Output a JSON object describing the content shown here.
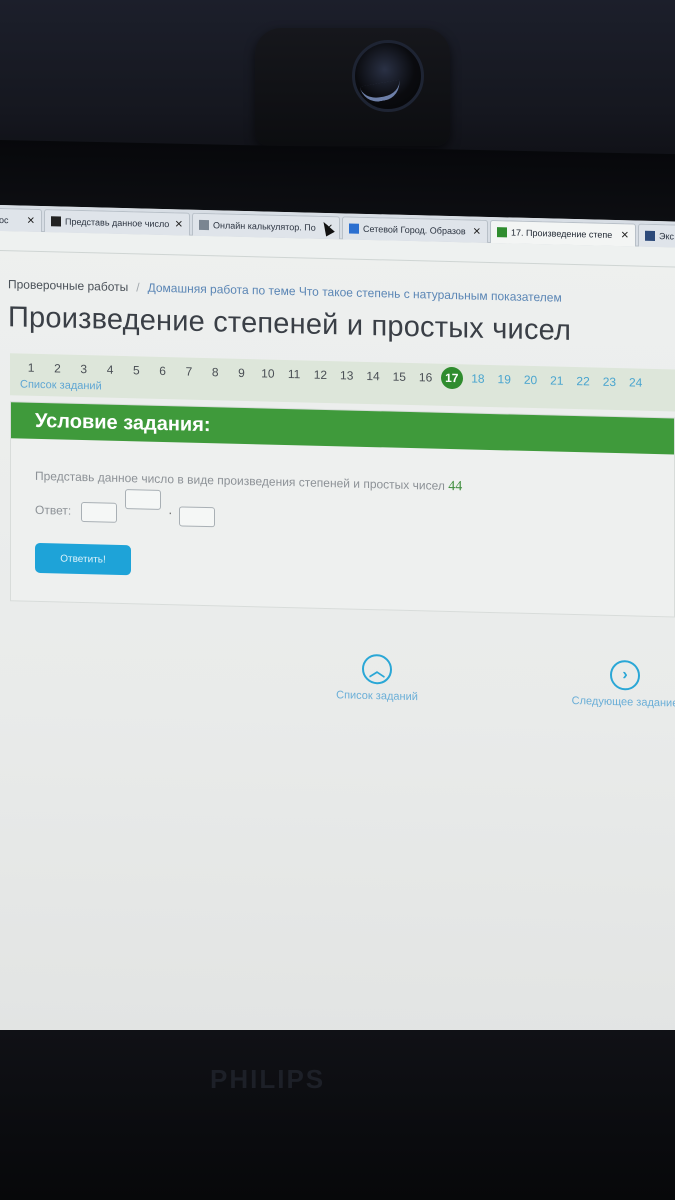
{
  "browser": {
    "tabs": [
      {
        "label": "ос",
        "favicon_color": "#c9cfd6"
      },
      {
        "label": "Представь данное число",
        "favicon_color": "#222222"
      },
      {
        "label": "Онлайн калькулятор. По",
        "favicon_color": "#7a8591"
      },
      {
        "label": "Сетевой Город. Образов",
        "favicon_color": "#2b6fd0"
      },
      {
        "label": "17. Произведение степе",
        "favicon_color": "#2f8c2e",
        "active": true
      },
      {
        "label": "Экс",
        "favicon_color": "#2d4a7a"
      }
    ]
  },
  "breadcrumb": {
    "root": "Проверочные работы",
    "separator": "/",
    "current": "Домашняя работа по теме Что такое степень с натуральным показателем"
  },
  "page_title": "Произведение степеней и простых чисел",
  "task_nav": {
    "numbers": [
      "1",
      "2",
      "3",
      "4",
      "5",
      "6",
      "7",
      "8",
      "9",
      "10",
      "11",
      "12",
      "13",
      "14",
      "15",
      "16",
      "17",
      "18",
      "19",
      "20",
      "21",
      "22",
      "23",
      "24"
    ],
    "current": "17",
    "list_link": "Список заданий"
  },
  "task": {
    "header": "Условие задания:",
    "question_text": "Представь данное число в виде произведения степеней и простых чисел",
    "number": "44",
    "answer_label": "Ответ:",
    "answer_dot": "·",
    "submit_label": "Ответить!"
  },
  "bottom_nav": {
    "list_label": "Список заданий",
    "next_label": "Следующее задание"
  },
  "monitor": {
    "brand": "PHILIPS"
  },
  "colors": {
    "accent_green": "#3f9a3b",
    "current_task": "#2f8c2e",
    "button_blue": "#1ea3d8",
    "link_blue": "#5b86b5"
  }
}
